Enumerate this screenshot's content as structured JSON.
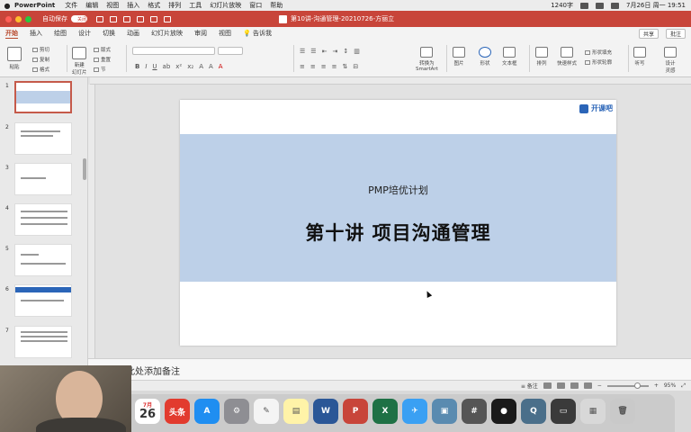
{
  "menubar": {
    "app_name": "PowerPoint",
    "items": [
      "文件",
      "编辑",
      "视图",
      "插入",
      "格式",
      "排列",
      "工具",
      "幻灯片放映",
      "窗口",
      "帮助"
    ],
    "input_method": "1240字",
    "datetime": "7月26日 周一  19:51"
  },
  "titlebar": {
    "autosave_label": "自动保存",
    "autosave_state": "关闭",
    "document_title": "第10讲-沟通管理-20210726-方丽立"
  },
  "tabs": {
    "items": [
      "开始",
      "插入",
      "绘图",
      "设计",
      "切换",
      "动画",
      "幻灯片放映",
      "审阅",
      "视图"
    ],
    "active": "开始",
    "tell_me": "告诉我",
    "share_label": "共享",
    "comments_label": "批注"
  },
  "ribbon": {
    "paste": "粘贴",
    "cut": "剪切",
    "copy": "复制",
    "format": "格式",
    "new_slide": "新建\n幻灯片",
    "layout": "版式",
    "reset": "重置",
    "section": "节",
    "convert_smartart": "转换为\nSmartArt",
    "picture": "图片",
    "shape": "形状",
    "textbox": "文本框",
    "arrange": "排列",
    "quick_styles": "快速样式",
    "shape_fill": "形状填充",
    "shape_outline": "形状轮廓",
    "design_ideas": "设计\n灵感",
    "dictate": "听写"
  },
  "thumbnails": [
    {
      "number": "1",
      "active": true
    },
    {
      "number": "2",
      "active": false
    },
    {
      "number": "3",
      "active": false
    },
    {
      "number": "4",
      "active": false
    },
    {
      "number": "5",
      "active": false
    },
    {
      "number": "6",
      "active": false
    },
    {
      "number": "7",
      "active": false
    }
  ],
  "slide": {
    "logo_text": "开课吧",
    "subtitle": "PMP培优计划",
    "title": "第十讲 项目沟通管理"
  },
  "notes": {
    "placeholder": "单击此处添加备注"
  },
  "statusbar": {
    "notes_label": "备注",
    "zoom": "95%"
  },
  "dock": {
    "calendar_month": "7月",
    "calendar_day": "26",
    "toutiao": "头条"
  },
  "colors": {
    "titlebar": "#c8453a",
    "slide_band": "#bdd0e8",
    "logo_blue": "#2b65b8",
    "active_tab": "#b7472a"
  }
}
